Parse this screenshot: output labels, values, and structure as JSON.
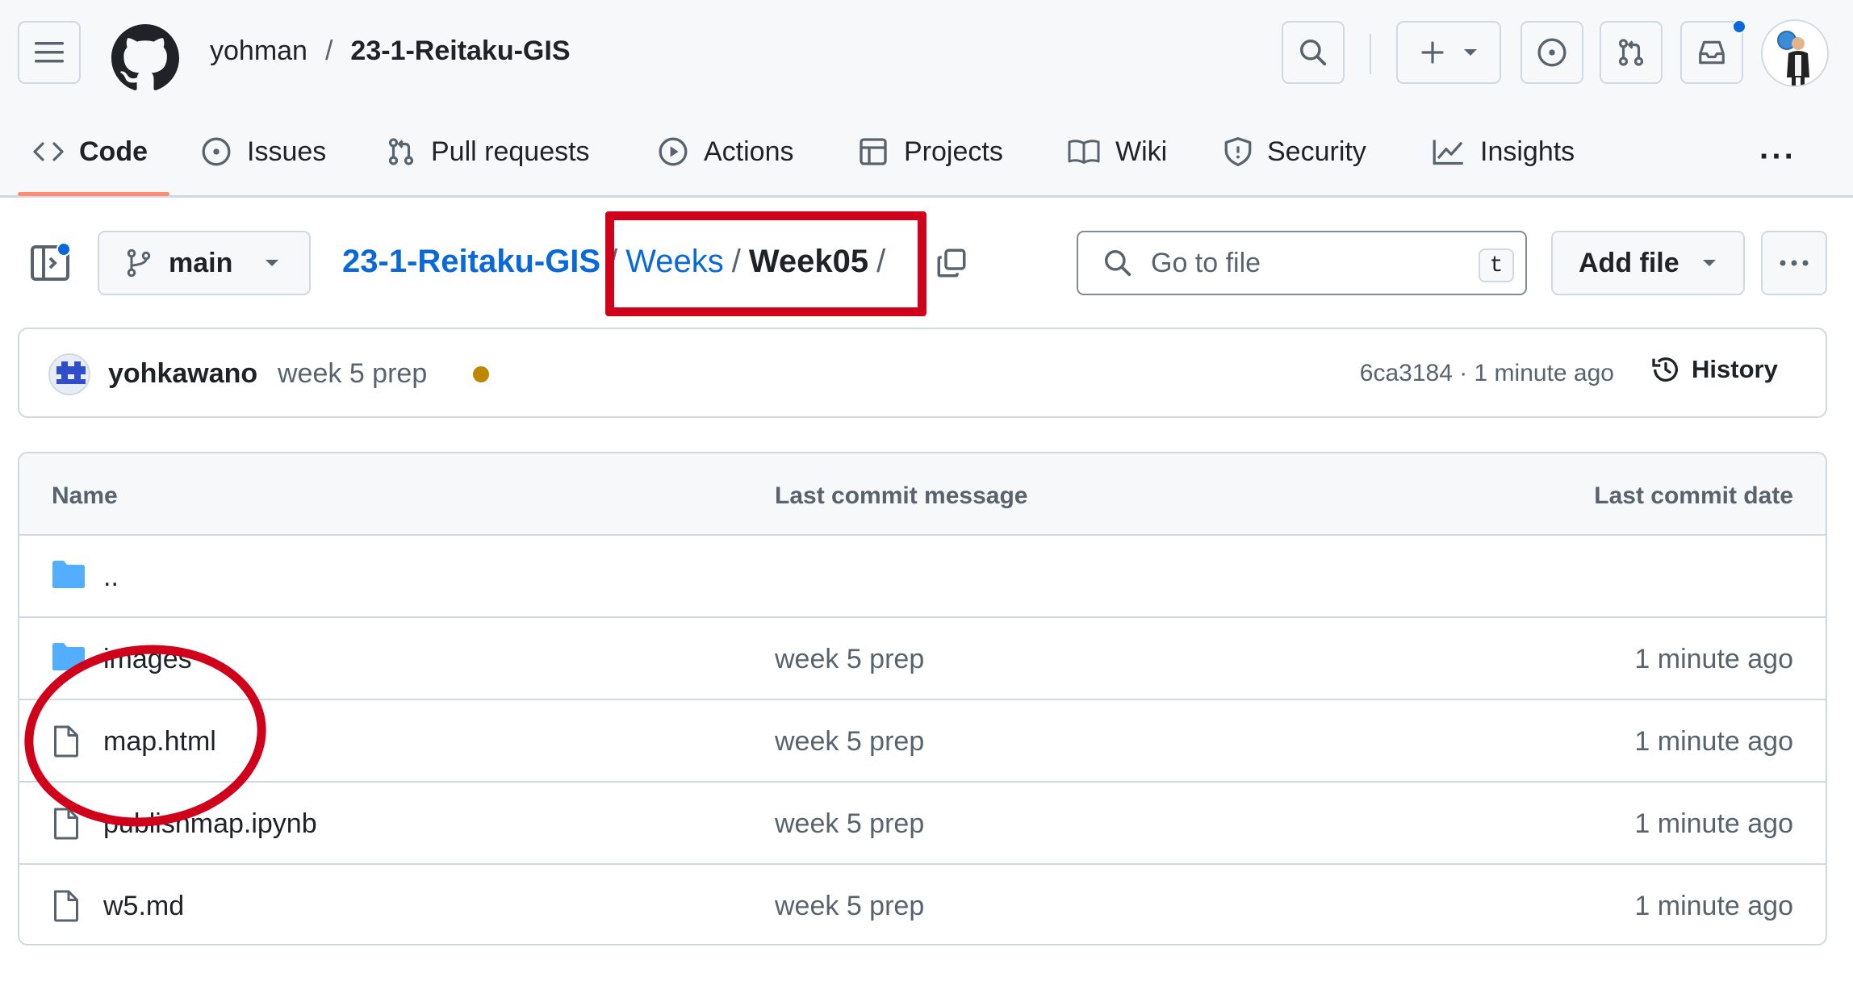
{
  "header": {
    "owner": "yohman",
    "separator": "/",
    "repo": "23-1-Reitaku-GIS"
  },
  "tabs": [
    {
      "label": "Code",
      "icon": "code-icon",
      "selected": true
    },
    {
      "label": "Issues",
      "icon": "issue-opened-icon"
    },
    {
      "label": "Pull requests",
      "icon": "git-pull-request-icon"
    },
    {
      "label": "Actions",
      "icon": "play-icon"
    },
    {
      "label": "Projects",
      "icon": "table-icon"
    },
    {
      "label": "Wiki",
      "icon": "book-icon"
    },
    {
      "label": "Security",
      "icon": "shield-icon"
    },
    {
      "label": "Insights",
      "icon": "graph-icon"
    }
  ],
  "branch": {
    "name": "main"
  },
  "breadcrumb": {
    "root": "23-1-Reitaku-GIS",
    "sep": "/",
    "folder": "Weeks",
    "current": "Week05"
  },
  "search": {
    "placeholder": "Go to file",
    "shortcut": "t"
  },
  "add_file": {
    "label": "Add file"
  },
  "commit": {
    "author": "yohkawano",
    "message": "week 5 prep",
    "status_color": "#bf8700",
    "meta": "6ca3184 · 1 minute ago",
    "history_label": "History"
  },
  "table": {
    "headers": {
      "name": "Name",
      "message": "Last commit message",
      "date": "Last commit date"
    },
    "rows": [
      {
        "type": "folder",
        "name": "..",
        "message": "",
        "date": ""
      },
      {
        "type": "folder",
        "name": "images",
        "message": "week 5 prep",
        "date": "1 minute ago"
      },
      {
        "type": "file",
        "name": "map.html",
        "message": "week 5 prep",
        "date": "1 minute ago"
      },
      {
        "type": "file",
        "name": "publishmap.ipynb",
        "message": "week 5 prep",
        "date": "1 minute ago"
      },
      {
        "type": "file",
        "name": "w5.md",
        "message": "week 5 prep",
        "date": "1 minute ago"
      }
    ]
  },
  "colors": {
    "accent": "#0969da",
    "annotation": "#d0021b",
    "selected_tab_underline": "#fd8c73"
  }
}
